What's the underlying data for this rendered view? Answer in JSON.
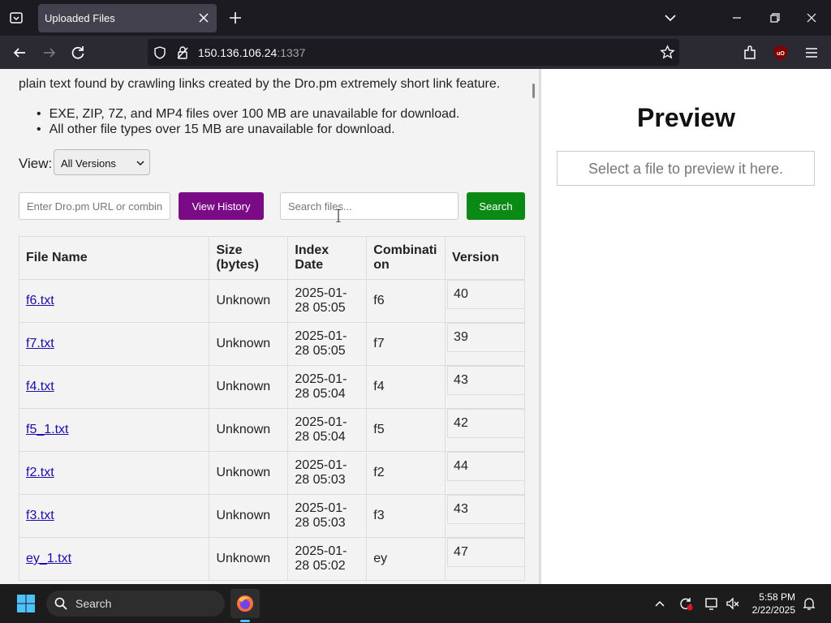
{
  "browser": {
    "tab_title": "Uploaded Files",
    "url_host": "150.136.106.24",
    "url_port": ":1337"
  },
  "page": {
    "intro_text": "plain text found by crawling links created by the Dro.pm extremely short link feature.",
    "bullets": [
      "EXE, ZIP, 7Z, and MP4 files over 100 MB are unavailable for download.",
      "All other file types over 15 MB are unavailable for download."
    ],
    "view_label": "View:",
    "view_selected": "All Versions",
    "url_input_placeholder": "Enter Dro.pm URL or combin",
    "view_history_label": "View History",
    "search_placeholder": "Search files...",
    "search_label": "Search",
    "colors": {
      "history_button": "#7a0a85",
      "search_button": "#0a8a14"
    }
  },
  "table": {
    "headers": [
      "File Name",
      "Size (bytes)",
      "Index Date",
      "Combination",
      "Version"
    ],
    "rows": [
      {
        "name": "f6.txt",
        "size": "Unknown",
        "date": "2025-01-28 05:05",
        "combo": "f6",
        "version": "40"
      },
      {
        "name": "f7.txt",
        "size": "Unknown",
        "date": "2025-01-28 05:05",
        "combo": "f7",
        "version": "39"
      },
      {
        "name": "f4.txt",
        "size": "Unknown",
        "date": "2025-01-28 05:04",
        "combo": "f4",
        "version": "43"
      },
      {
        "name": "f5_1.txt",
        "size": "Unknown",
        "date": "2025-01-28 05:04",
        "combo": "f5",
        "version": "42"
      },
      {
        "name": "f2.txt",
        "size": "Unknown",
        "date": "2025-01-28 05:03",
        "combo": "f2",
        "version": "44"
      },
      {
        "name": "f3.txt",
        "size": "Unknown",
        "date": "2025-01-28 05:03",
        "combo": "f3",
        "version": "43"
      },
      {
        "name": "ey_1.txt",
        "size": "Unknown",
        "date": "2025-01-28 05:02",
        "combo": "ey",
        "version": "47"
      }
    ]
  },
  "preview": {
    "title": "Preview",
    "placeholder": "Select a file to preview it here."
  },
  "taskbar": {
    "search_label": "Search",
    "time": "5:58 PM",
    "date": "2/22/2025"
  }
}
